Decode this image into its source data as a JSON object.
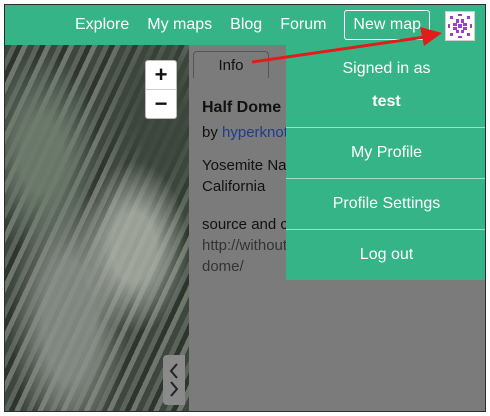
{
  "topnav": {
    "explore": "Explore",
    "my_maps": "My maps",
    "blog": "Blog",
    "forum": "Forum",
    "new_map": "New map"
  },
  "map": {
    "zoom_in": "+",
    "zoom_out": "−"
  },
  "panel": {
    "tab_info": "Info",
    "title": "Half Dome",
    "by_prefix": "by",
    "author": "hyperknot",
    "location_line1": "Yosemite National Park,",
    "location_line2": "California",
    "source_line": "source and credit:",
    "url_line1": "http://withoutbeta.com/half-",
    "url_line2": "dome/"
  },
  "dropdown": {
    "signed_in_as": "Signed in as",
    "username": "test",
    "my_profile": "My Profile",
    "profile_settings": "Profile Settings",
    "log_out": "Log out"
  },
  "colors": {
    "brand_green": "#34b487",
    "panel_gray": "#7b7b7b",
    "annotation_arrow": "#e31b1b",
    "avatar_purple": "#9b3fd1"
  },
  "icons": {
    "avatar": "avatar-identicon-icon",
    "collapse": "chevron-double-icon"
  }
}
